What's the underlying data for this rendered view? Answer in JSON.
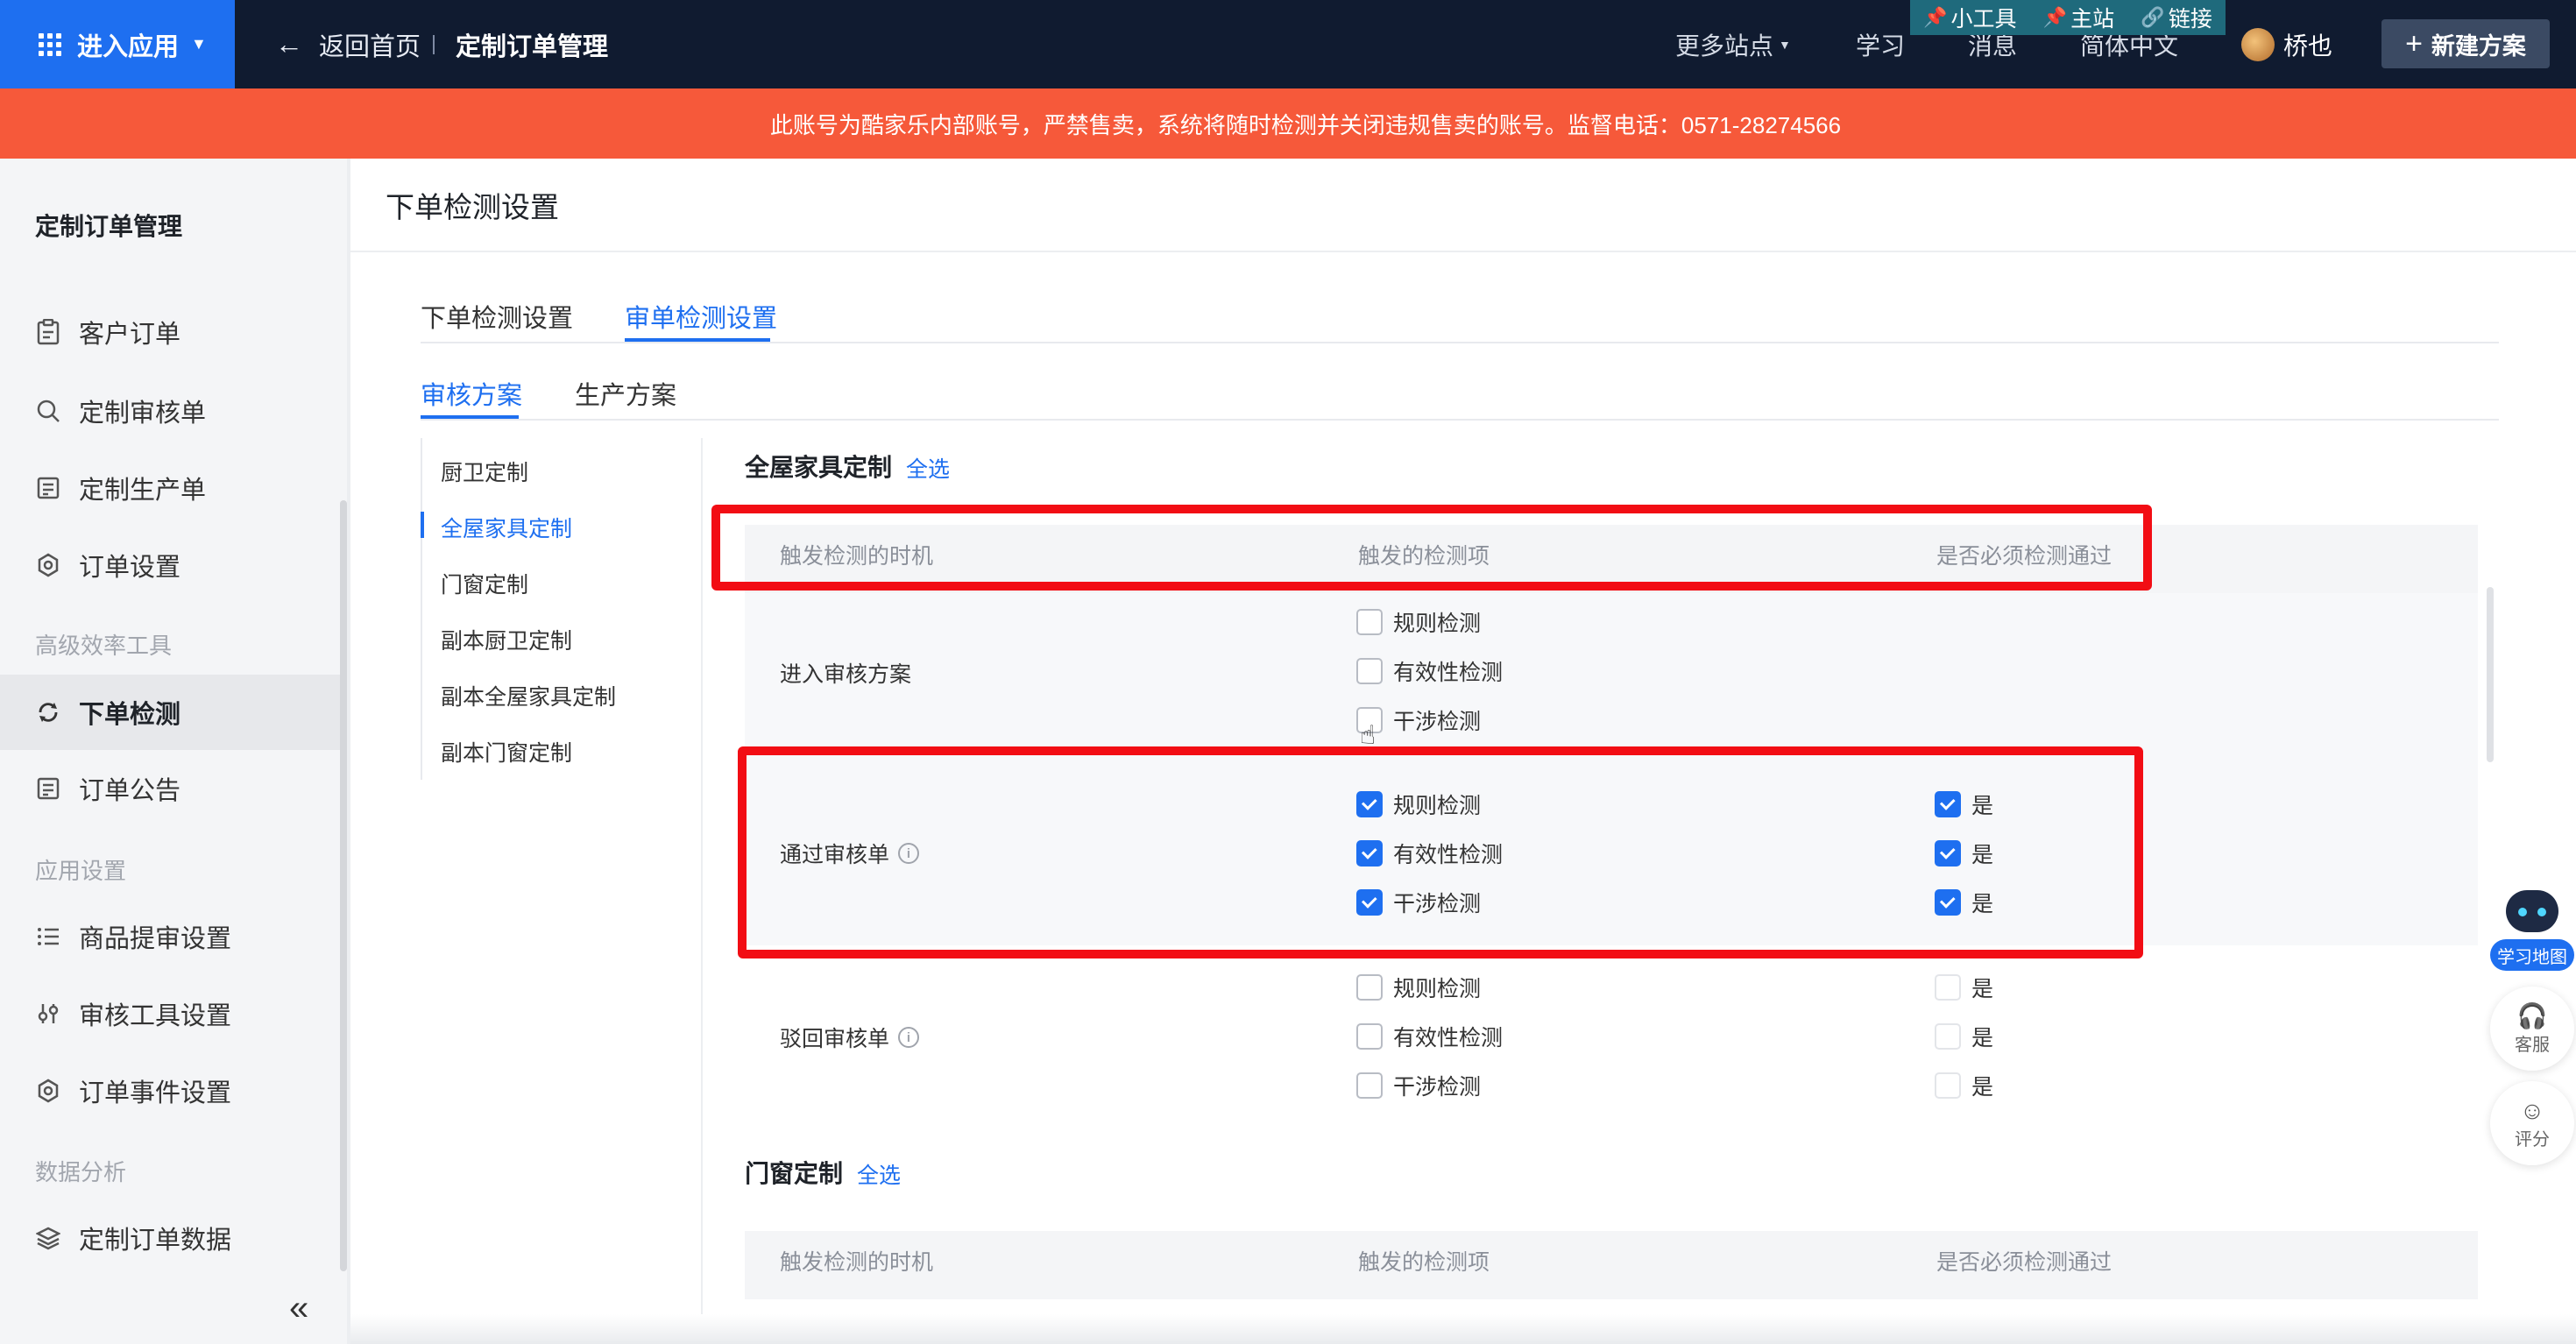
{
  "topbar": {
    "app_button": "进入应用",
    "back_label": "返回首页",
    "current_page": "定制订单管理",
    "nav": [
      "更多站点",
      "学习",
      "消息",
      "简体中文"
    ],
    "tools": [
      "小工具",
      "主站",
      "链接"
    ],
    "user_name": "桥也",
    "new_button": "新建方案"
  },
  "banner": {
    "text": "此账号为酷家乐内部账号，严禁售卖，系统将随时检测并关闭违规售卖的账号。监督电话：0571-28274566"
  },
  "sidebar": {
    "title": "定制订单管理",
    "items": [
      {
        "label": "客户订单",
        "icon": "clipboard-icon"
      },
      {
        "label": "定制审核单",
        "icon": "search-icon"
      },
      {
        "label": "定制生产单",
        "icon": "document-icon"
      },
      {
        "label": "订单设置",
        "icon": "gear-icon"
      }
    ],
    "group_efficiency": "高级效率工具",
    "efficiency_items": [
      {
        "label": "下单检测",
        "icon": "refresh-icon",
        "active": true
      },
      {
        "label": "订单公告",
        "icon": "notice-icon"
      }
    ],
    "group_app_settings": "应用设置",
    "app_settings_items": [
      {
        "label": "商品提审设置",
        "icon": "list-icon"
      },
      {
        "label": "审核工具设置",
        "icon": "sliders-icon"
      },
      {
        "label": "订单事件设置",
        "icon": "gear-icon"
      }
    ],
    "group_data": "数据分析",
    "data_items": [
      {
        "label": "定制订单数据",
        "icon": "layers-icon"
      }
    ]
  },
  "main": {
    "page_title": "下单检测设置",
    "tabs": [
      "下单检测设置",
      "审单检测设置"
    ],
    "active_tab": "审单检测设置",
    "sub_tabs": [
      "审核方案",
      "生产方案"
    ],
    "active_sub_tab": "审核方案",
    "categories": [
      "厨卫定制",
      "全屋家具定制",
      "门窗定制",
      "副本厨卫定制",
      "副本全屋家具定制",
      "副本门窗定制"
    ],
    "active_category": "全屋家具定制",
    "select_all": "全选",
    "table_headers": [
      "触发检测的时机",
      "触发的检测项",
      "是否必须检测通过"
    ],
    "section1": {
      "title": "全屋家具定制",
      "rows": [
        {
          "trigger": "进入审核方案",
          "items": [
            {
              "label": "规则检测",
              "checked": false
            },
            {
              "label": "有效性检测",
              "checked": false
            },
            {
              "label": "干涉检测",
              "checked": false
            }
          ],
          "required": []
        },
        {
          "trigger": "通过审核单",
          "items": [
            {
              "label": "规则检测",
              "checked": true
            },
            {
              "label": "有效性检测",
              "checked": true
            },
            {
              "label": "干涉检测",
              "checked": true
            }
          ],
          "required": [
            {
              "label": "是",
              "checked": true
            },
            {
              "label": "是",
              "checked": true
            },
            {
              "label": "是",
              "checked": true
            }
          ]
        },
        {
          "trigger": "驳回审核单",
          "items": [
            {
              "label": "规则检测",
              "checked": false
            },
            {
              "label": "有效性检测",
              "checked": false
            },
            {
              "label": "干涉检测",
              "checked": false
            }
          ],
          "required": [
            {
              "label": "是",
              "checked": false
            },
            {
              "label": "是",
              "checked": false
            },
            {
              "label": "是",
              "checked": false
            }
          ]
        }
      ]
    },
    "section2": {
      "title": "门窗定制"
    }
  },
  "floating": {
    "study_map": "学习地图",
    "service": "客服",
    "rating": "评分"
  },
  "colors": {
    "accent": "#1e6ff0",
    "banner": "#f6593a",
    "topbar": "#101b30",
    "highlight": "#f20d14"
  }
}
